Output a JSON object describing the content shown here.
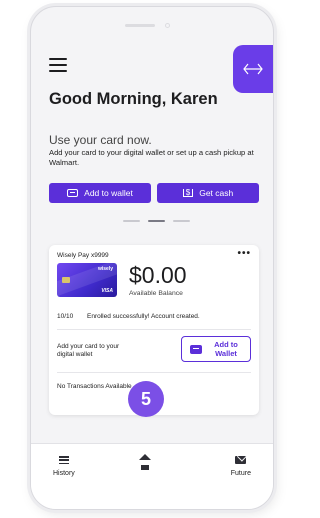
{
  "header": {
    "greeting": "Good Morning, Karen",
    "use_card_title": "Use your card now.",
    "use_card_subtitle": "Add your card to your digital wallet or set up a cash pickup at Walmart."
  },
  "actions": {
    "add_to_wallet": "Add to wallet",
    "get_cash": "Get cash"
  },
  "account": {
    "name": "Wisely Pay x9999",
    "more": "•••",
    "card_brand": "wisely",
    "card_network": "VISA",
    "balance": "$0.00",
    "balance_label": "Available Balance",
    "enroll_date": "10/10",
    "enroll_message": "Enrolled successfully! Account created.",
    "add_prompt": "Add your card to your digital wallet",
    "add_button": "Add to Wallet",
    "no_transactions": "No Transactions Available"
  },
  "nav": {
    "history": "History",
    "future": "Future"
  },
  "step": "5",
  "colors": {
    "accent": "#5b2fd9",
    "badge": "#7b4fe6"
  }
}
